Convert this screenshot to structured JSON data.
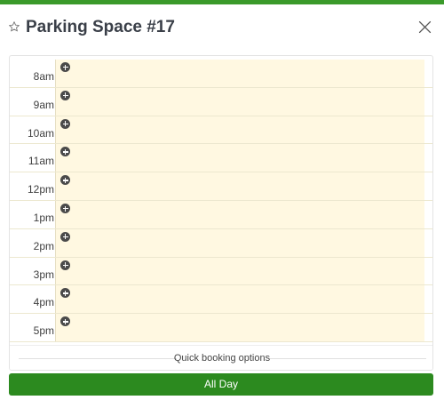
{
  "modal": {
    "title": "Parking Space #17",
    "close_icon": "close-x-icon",
    "favorite_icon": "star-outline-icon"
  },
  "timetable": {
    "add_icon": "plus-circle-icon",
    "slot_color": "#fff8e1",
    "rows": [
      {
        "time": "8am"
      },
      {
        "time": "9am"
      },
      {
        "time": "10am"
      },
      {
        "time": "11am"
      },
      {
        "time": "12pm"
      },
      {
        "time": "1pm"
      },
      {
        "time": "2pm"
      },
      {
        "time": "3pm"
      },
      {
        "time": "4pm"
      },
      {
        "time": "5pm"
      }
    ]
  },
  "quick_booking": {
    "label": "Quick booking options",
    "all_day_label": "All Day",
    "button_color": "#2c8a1f"
  }
}
